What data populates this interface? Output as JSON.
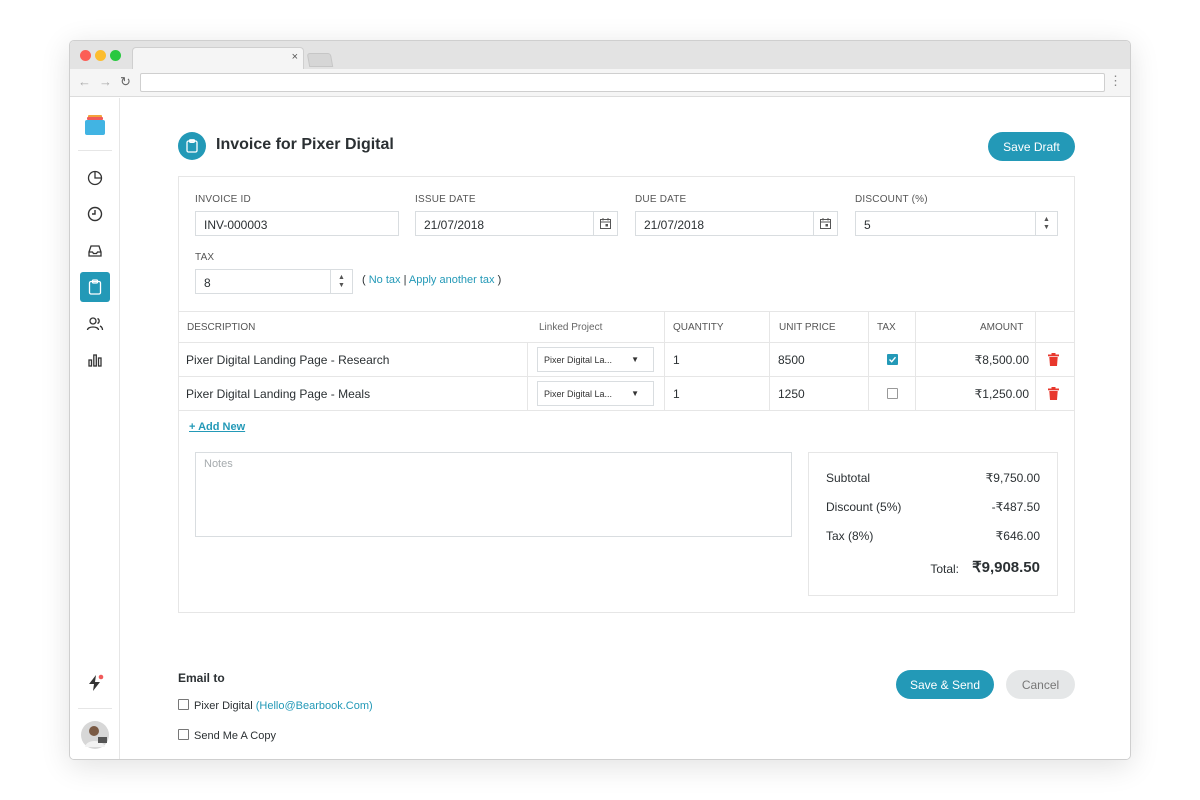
{
  "browser": {
    "close_glyph": "×",
    "menu_glyph": "⋮",
    "back_glyph": "←",
    "forward_glyph": "→",
    "reload_glyph": "↻"
  },
  "sidebar": {
    "items": [
      {
        "icon": "pie-chart-icon"
      },
      {
        "icon": "clock-icon"
      },
      {
        "icon": "inbox-icon"
      },
      {
        "icon": "clipboard-icon",
        "active": true
      },
      {
        "icon": "users-icon"
      },
      {
        "icon": "bar-chart-icon"
      }
    ],
    "bottom": [
      "lightning-icon",
      "avatar"
    ]
  },
  "header": {
    "title": "Invoice for Pixer Digital",
    "save_draft_label": "Save Draft"
  },
  "form": {
    "invoice_id_label": "INVOICE ID",
    "invoice_id": "INV-000003",
    "issue_date_label": "ISSUE DATE",
    "issue_date": "21/07/2018",
    "due_date_label": "DUE DATE",
    "due_date": "21/07/2018",
    "discount_label": "DISCOUNT (%)",
    "discount": "5",
    "tax_label": "TAX",
    "tax": "8",
    "tax_links": {
      "open": "(",
      "no_tax": "No tax",
      "sep": "|",
      "apply_another": "Apply another tax",
      "close": ")"
    }
  },
  "table": {
    "headers": {
      "description": "DESCRIPTION",
      "linked_project": "Linked Project",
      "quantity": "QUANTITY",
      "unit_price": "UNIT PRICE",
      "tax": "TAX",
      "amount": "AMOUNT"
    },
    "rows": [
      {
        "description": "Pixer Digital Landing Page - Research",
        "project": "Pixer Digital La...",
        "quantity": "1",
        "unit_price": "8500",
        "tax_checked": true,
        "amount": "₹8,500.00"
      },
      {
        "description": "Pixer Digital Landing Page - Meals",
        "project": "Pixer Digital La...",
        "quantity": "1",
        "unit_price": "1250",
        "tax_checked": false,
        "amount": "₹1,250.00"
      }
    ],
    "caret_glyph": "▼",
    "add_new_label": "+ Add New"
  },
  "notes": {
    "placeholder": "Notes"
  },
  "totals": {
    "subtotal_label": "Subtotal",
    "subtotal": "₹9,750.00",
    "discount_label": "Discount (5%)",
    "discount": "-₹487.50",
    "tax_label": "Tax (8%)",
    "tax": "₹646.00",
    "total_label": "Total:",
    "total": "₹9,908.50"
  },
  "email": {
    "title": "Email to",
    "recipient_name": "Pixer Digital",
    "recipient_email": "(Hello@Bearbook.Com)",
    "copy_label": "Send Me A Copy"
  },
  "actions": {
    "save_send_label": "Save & Send",
    "cancel_label": "Cancel"
  },
  "colors": {
    "accent": "#2399b7",
    "danger": "#e8372c",
    "notification": "#f05a5a"
  }
}
